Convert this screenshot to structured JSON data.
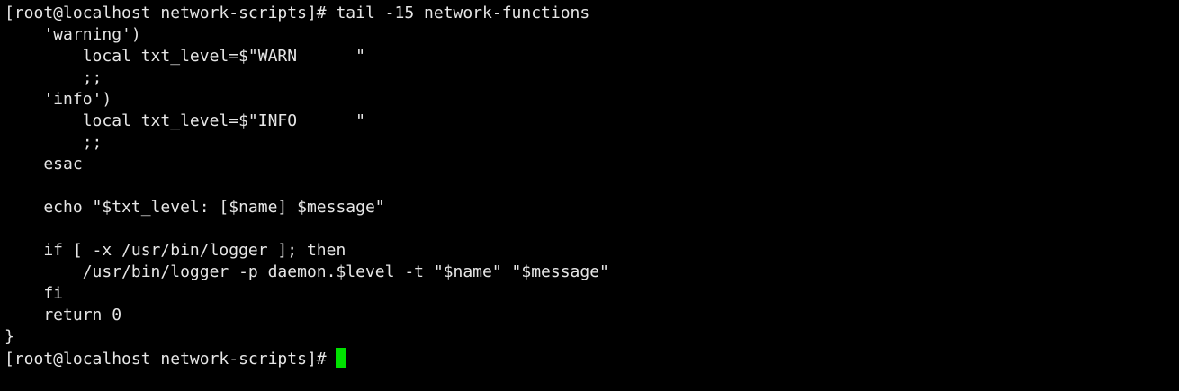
{
  "terminal": {
    "prompt": "[root@localhost network-scripts]#",
    "command": "tail -15 network-functions",
    "output": [
      "    'warning')",
      "        local txt_level=$\"WARN      \"",
      "        ;;",
      "    'info')",
      "        local txt_level=$\"INFO      \"",
      "        ;;",
      "    esac",
      "",
      "    echo \"$txt_level: [$name] $message\"",
      "",
      "    if [ -x /usr/bin/logger ]; then",
      "        /usr/bin/logger -p daemon.$level -t \"$name\" \"$message\"",
      "    fi",
      "    return 0",
      "}"
    ],
    "cursor_color": "#00e100"
  }
}
